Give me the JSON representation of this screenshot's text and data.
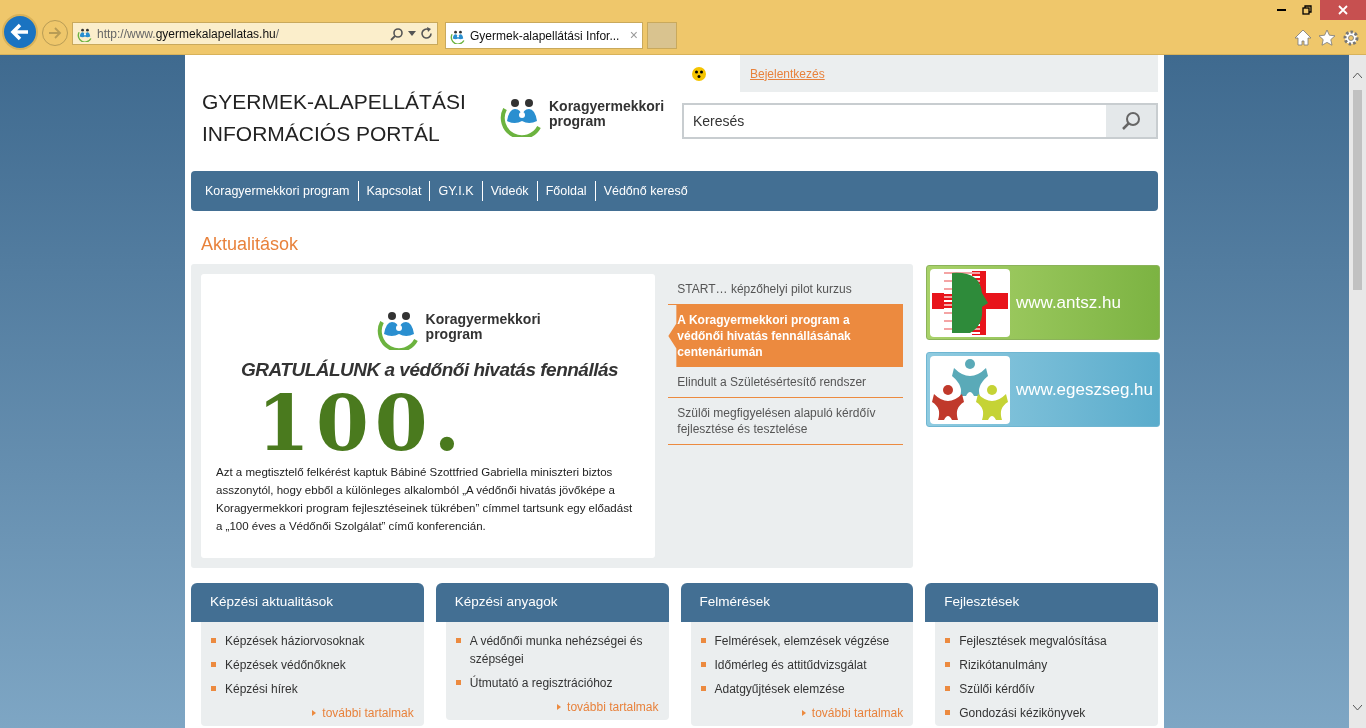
{
  "browser": {
    "url_prefix": "http://www.",
    "url_domain": "gyermekalapellatas.hu",
    "url_suffix": "/",
    "tab_title": "Gyermek-alapellátási Infor...",
    "tab_close": "×"
  },
  "header": {
    "title_line1": "GYERMEK-ALAPELLÁTÁSI",
    "title_line2": "INFORMÁCIÓS PORTÁL",
    "logo_line1": "Koragyermekkori",
    "logo_line2": "program",
    "login": "Bejelentkezés",
    "search_placeholder": "Keresés"
  },
  "nav": [
    "Koragyermekkori program",
    "Kapcsolat",
    "GY.I.K",
    "Videók",
    "Főoldal",
    "Védőnő kereső"
  ],
  "news": {
    "heading": "Aktualitások",
    "slide": {
      "logo_line1": "Koragyermekkori",
      "logo_line2": "program",
      "headline": "GRATULÁLUNK a védőnői hivatás fennállás",
      "big_number": "100.",
      "caption": "Azt a megtisztelő felkérést kaptuk Bábiné Szottfried Gabriella miniszteri biztos asszonytól, hogy ebből a különleges alkalomból „A védőnői hivatás jövőképe a Koragyermekkori program fejlesztéseinek tükrében” címmel tartsunk egy előadást a „100 éves a Védőnői Szolgálat” című konferencián."
    },
    "items": [
      {
        "title": "START… képzőhelyi pilot kurzus",
        "selected": false
      },
      {
        "title": "A Koragyermekkori program a védőnői hivatás fennállásának centenáriumán",
        "selected": true
      },
      {
        "title": "Elindult a Születésértesítő rendszer",
        "selected": false
      },
      {
        "title": "Szülői megfigyelésen alapuló kérdőív fejlesztése és tesztelése",
        "selected": false
      }
    ]
  },
  "banners": [
    {
      "kind": "antsz",
      "label": "www.antsz.hu"
    },
    {
      "kind": "egeszseg",
      "label": "www.egeszseg.hu"
    }
  ],
  "boxes": [
    {
      "title": "Képzési aktualitások",
      "items": [
        "Képzések háziorvosoknak",
        "Képzések védőnőknek",
        "Képzési hírek"
      ],
      "more": "további tartalmak"
    },
    {
      "title": "Képzési anyagok",
      "items": [
        "A védőnői munka nehézségei és szépségei",
        "Útmutató a regisztrációhoz"
      ],
      "more": "további tartalmak"
    },
    {
      "title": "Felmérések",
      "items": [
        "Felmérések, elemzések végzése",
        "Időmérleg és attitűdvizsgálat",
        "Adatgyűjtések elemzése"
      ],
      "more": "további tartalmak"
    },
    {
      "title": "Fejlesztések",
      "items": [
        "Fejlesztések megvalósítása",
        "Rizikótanulmány",
        "Szülői kérdőív",
        "Gondozási kézikönyvek"
      ]
    }
  ]
}
